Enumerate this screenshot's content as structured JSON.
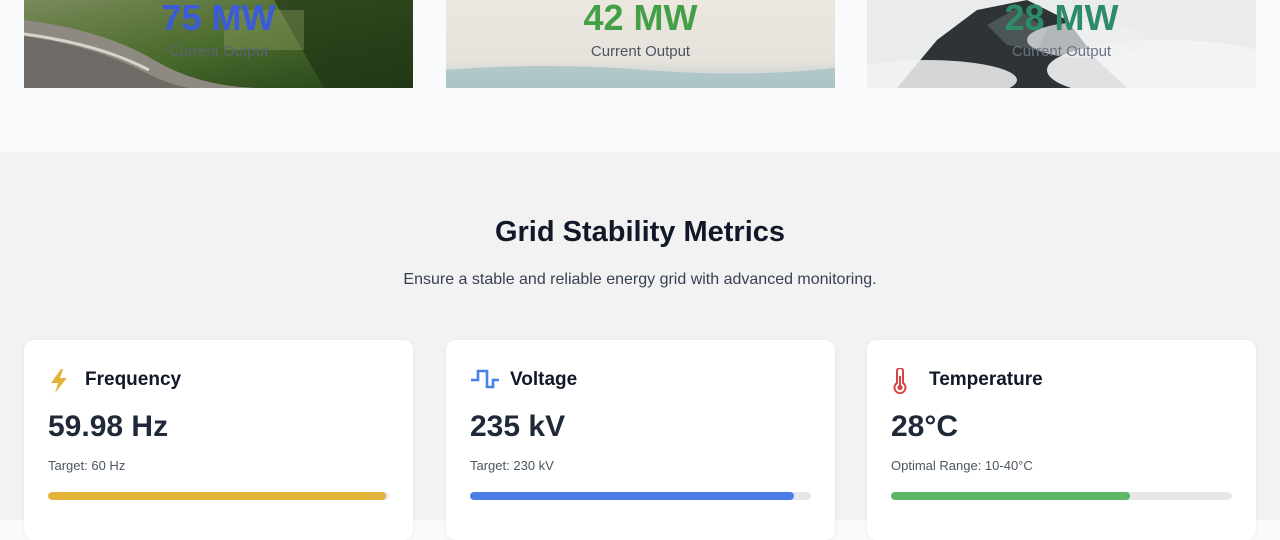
{
  "generation_cards": [
    {
      "value": "75 MW",
      "label": "Current Output",
      "color": "#3b5bdb"
    },
    {
      "value": "42 MW",
      "label": "Current Output",
      "color": "#43a047"
    },
    {
      "value": "28 MW",
      "label": "Current Output",
      "color": "#2e8b68"
    }
  ],
  "grid_section": {
    "title": "Grid Stability Metrics",
    "subtitle": "Ensure a stable and reliable energy grid with advanced monitoring."
  },
  "metrics": [
    {
      "icon": "lightning-bolt-icon",
      "name": "Frequency",
      "value": "59.98 Hz",
      "target": "Target: 60 Hz",
      "progress": 0.99,
      "color": "#e2b53a"
    },
    {
      "icon": "square-wave-icon",
      "name": "Voltage",
      "value": "235 kV",
      "target": "Target: 230 kV",
      "progress": 0.95,
      "color": "#4a7fe8"
    },
    {
      "icon": "thermometer-icon",
      "name": "Temperature",
      "value": "28°C",
      "target": "Optimal Range: 10-40°C",
      "progress": 0.7,
      "color": "#5ab864"
    }
  ]
}
